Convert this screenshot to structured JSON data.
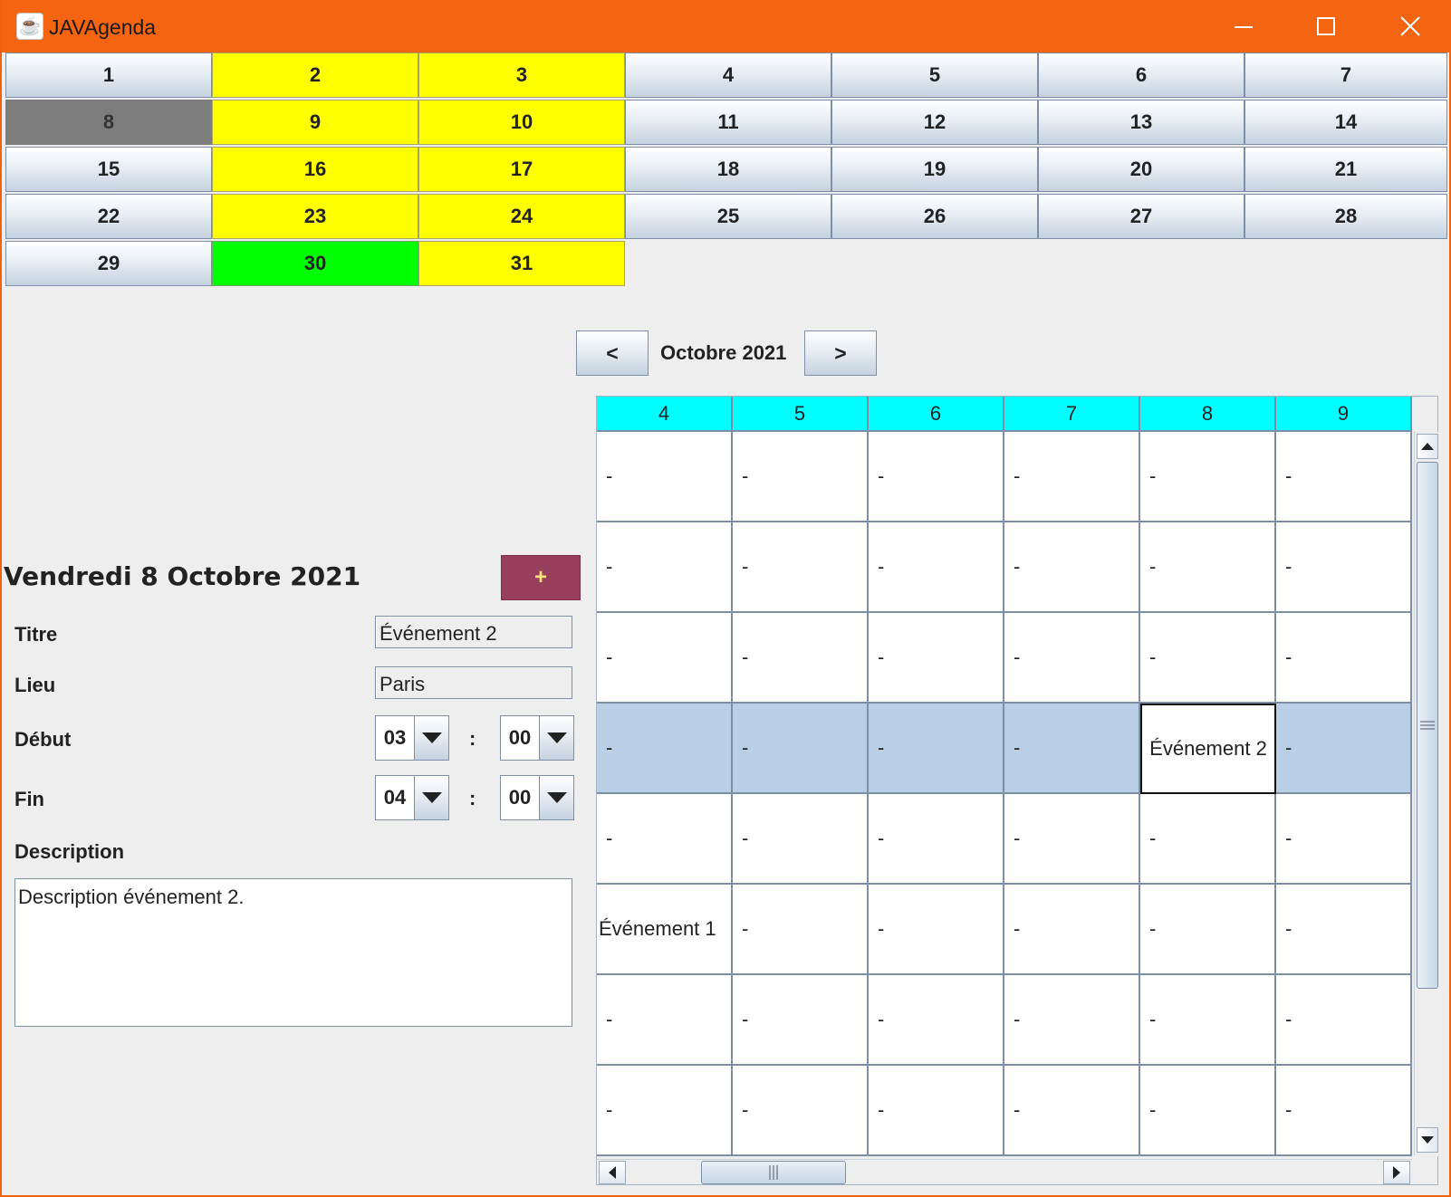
{
  "window": {
    "title": "JAVAgenda"
  },
  "month_days": [
    {
      "label": "1",
      "state": "normal"
    },
    {
      "label": "2",
      "state": "yellow"
    },
    {
      "label": "3",
      "state": "yellow"
    },
    {
      "label": "4",
      "state": "normal"
    },
    {
      "label": "5",
      "state": "normal"
    },
    {
      "label": "6",
      "state": "normal"
    },
    {
      "label": "7",
      "state": "normal"
    },
    {
      "label": "8",
      "state": "gray"
    },
    {
      "label": "9",
      "state": "yellow"
    },
    {
      "label": "10",
      "state": "yellow"
    },
    {
      "label": "11",
      "state": "normal"
    },
    {
      "label": "12",
      "state": "normal"
    },
    {
      "label": "13",
      "state": "normal"
    },
    {
      "label": "14",
      "state": "normal"
    },
    {
      "label": "15",
      "state": "normal"
    },
    {
      "label": "16",
      "state": "yellow"
    },
    {
      "label": "17",
      "state": "yellow"
    },
    {
      "label": "18",
      "state": "normal"
    },
    {
      "label": "19",
      "state": "normal"
    },
    {
      "label": "20",
      "state": "normal"
    },
    {
      "label": "21",
      "state": "normal"
    },
    {
      "label": "22",
      "state": "normal"
    },
    {
      "label": "23",
      "state": "yellow"
    },
    {
      "label": "24",
      "state": "yellow"
    },
    {
      "label": "25",
      "state": "normal"
    },
    {
      "label": "26",
      "state": "normal"
    },
    {
      "label": "27",
      "state": "normal"
    },
    {
      "label": "28",
      "state": "normal"
    },
    {
      "label": "29",
      "state": "normal"
    },
    {
      "label": "30",
      "state": "green"
    },
    {
      "label": "31",
      "state": "yellow"
    }
  ],
  "month_nav": {
    "prev_label": "<",
    "month_label": "Octobre 2021",
    "next_label": ">"
  },
  "event_form": {
    "date_heading": "Vendredi 8 Octobre 2021",
    "add_label": "+",
    "titre_label": "Titre",
    "titre_value": "Événement 2",
    "lieu_label": "Lieu",
    "lieu_value": "Paris",
    "debut_label": "Début",
    "debut_hour": "03",
    "debut_minute": "00",
    "fin_label": "Fin",
    "fin_hour": "04",
    "fin_minute": "00",
    "time_separator": ":",
    "description_label": "Description",
    "description_value": "Description événement 2."
  },
  "week_grid": {
    "columns": [
      "4",
      "5",
      "6",
      "7",
      "8",
      "9"
    ],
    "rows": [
      [
        "-",
        "-",
        "-",
        "-",
        "-",
        "-"
      ],
      [
        "-",
        "-",
        "-",
        "-",
        "-",
        "-"
      ],
      [
        "-",
        "-",
        "-",
        "-",
        "-",
        "-"
      ],
      [
        "-",
        "-",
        "-",
        "-",
        "Événement 2",
        "-"
      ],
      [
        "-",
        "-",
        "-",
        "-",
        "-",
        "-"
      ],
      [
        "Événement 1",
        "-",
        "-",
        "-",
        "-",
        "-"
      ],
      [
        "-",
        "-",
        "-",
        "-",
        "-",
        "-"
      ],
      [
        "-",
        "-",
        "-",
        "-",
        "-",
        "-"
      ]
    ],
    "selected_row": 3,
    "focused_cell": [
      3,
      4
    ]
  },
  "colors": {
    "titlebar": "#f56411",
    "event_day": "#ffff00",
    "today": "#00ff00",
    "selected_day": "#7d7d7d",
    "grid_header": "#00ffff",
    "selected_row": "#b8cfe5",
    "add_button": "#993f5e"
  },
  "icons": {
    "app": "java-cup-icon",
    "minimize": "minimize-icon",
    "maximize": "maximize-icon",
    "close": "close-icon"
  }
}
